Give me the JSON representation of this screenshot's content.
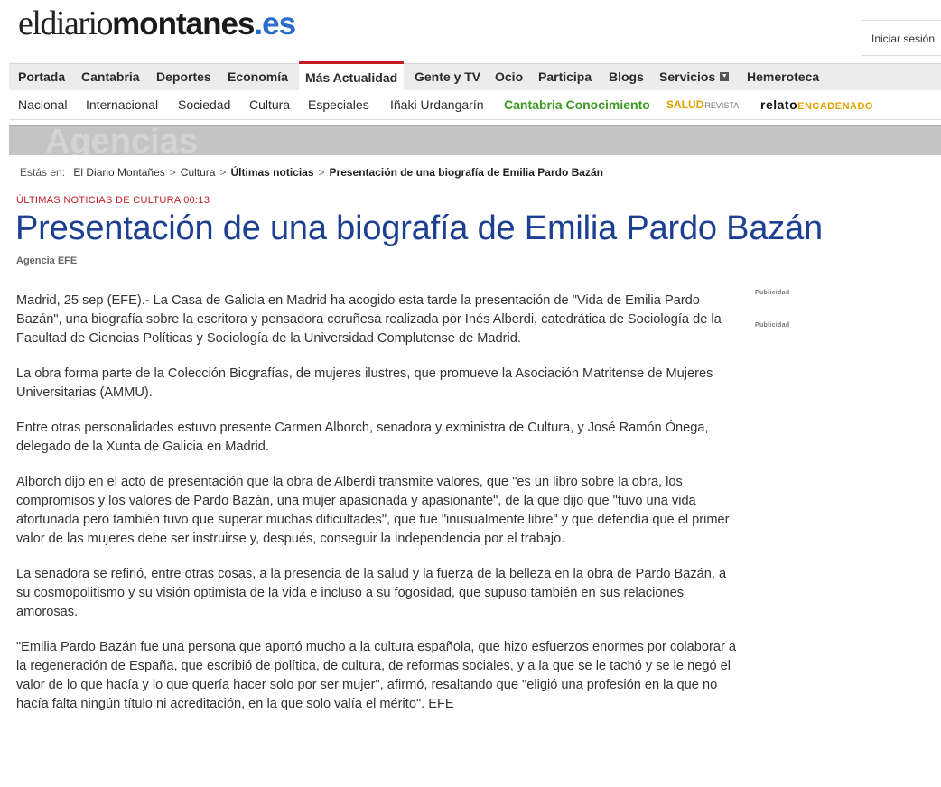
{
  "header": {
    "logo": {
      "part1": "eldiario",
      "part2": "montanes",
      "part3": ".es"
    },
    "login_label": "Iniciar sesión"
  },
  "nav_main": [
    "Portada",
    "Cantabria",
    "Deportes",
    "Economía",
    "Más Actualidad",
    "Gente y TV",
    "Ocio",
    "Participa",
    "Blogs",
    "Servicios",
    "Hemeroteca"
  ],
  "nav_main_active": "Más Actualidad",
  "nav_sub": {
    "items": [
      "Nacional",
      "Internacional",
      "Sociedad",
      "Cultura",
      "Especiales",
      "Iñaki Urdangarín",
      "Cantabria Conocimiento"
    ],
    "salud": "SALUD",
    "salud_sub": "REVISTA",
    "relato": "relato",
    "relato_sub": "ENCADENADO"
  },
  "section_banner": "Agencias",
  "breadcrumb": {
    "label": "Estás en:",
    "items": [
      "El Diario Montañes",
      "Cultura",
      "Últimas noticias",
      "Presentación de una biografía de Emilia Pardo Bazán"
    ]
  },
  "article": {
    "kicker": "ÚLTIMAS NOTICIAS DE CULTURA 00:13",
    "title": "Presentación de una biografía de Emilia Pardo Bazán",
    "source": "Agencia EFE",
    "paragraphs": [
      "Madrid, 25 sep (EFE).- La Casa de Galicia en Madrid ha acogido esta tarde la presentación de \"Vida de Emilia Pardo Bazán\", una biografía sobre la escritora y pensadora coruñesa realizada por Inés Alberdi, catedrática de Sociología de la Facultad de Ciencias Políticas y Sociología de la Universidad Complutense de Madrid.",
      "La obra forma parte de la Colección Biografías, de mujeres ilustres, que promueve la Asociación Matritense de Mujeres Universitarias (AMMU).",
      "Entre otras personalidades estuvo presente Carmen Alborch, senadora y exministra de Cultura, y José Ramón Ónega, delegado de la Xunta de Galicia en Madrid.",
      "Alborch dijo en el acto de presentación que la obra de Alberdi transmite valores, que \"es un libro sobre la obra, los compromisos y los valores de Pardo Bazán, una mujer apasionada y apasionante\", de la que dijo que \"tuvo una vida afortunada pero también tuvo que superar muchas dificultades\", que fue \"inusualmente libre\" y que defendía que el primer valor de las mujeres debe ser instruirse y, después, conseguir la independencia por el trabajo.",
      "La senadora se refirió, entre otras cosas, a la presencia de la salud y la fuerza de la belleza en la obra de Pardo Bazán, a su cosmopolitismo y su visión optimista de la vida e incluso a su fogosidad, que supuso también en sus relaciones amorosas.",
      "\"Emilia Pardo Bazán fue una persona que aportó mucho a la cultura española, que hizo esfuerzos enormes por colaborar a la regeneración de España, que escribió de política, de cultura, de reformas sociales, y a la que se le tachó y se le negó el valor de lo que hacía y lo que quería hacer solo por ser mujer\", afirmó, resaltando que \"eligió una profesión en la que no hacía falta ningún título ni acreditación, en la que solo valía el mérito\". EFE"
    ]
  },
  "ads": [
    "Publicidad",
    "Publicidad"
  ]
}
